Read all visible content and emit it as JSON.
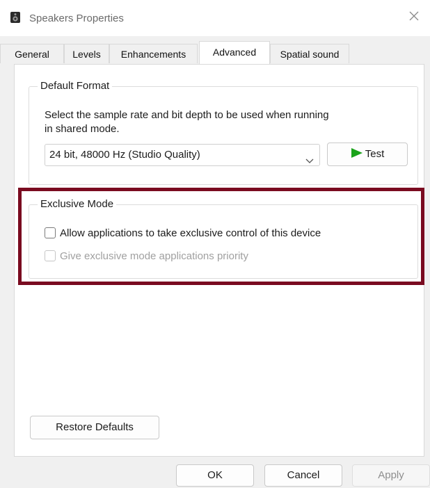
{
  "window": {
    "title": "Speakers Properties"
  },
  "tabs": [
    {
      "label": "General"
    },
    {
      "label": "Levels"
    },
    {
      "label": "Enhancements"
    },
    {
      "label": "Advanced"
    },
    {
      "label": "Spatial sound"
    }
  ],
  "active_tab": "Advanced",
  "default_format": {
    "legend": "Default Format",
    "description_line1": "Select the sample rate and bit depth to be used when running",
    "description_line2": "in shared mode.",
    "selected_format": "24 bit, 48000 Hz (Studio Quality)",
    "test_label": "Test"
  },
  "exclusive_mode": {
    "legend": "Exclusive Mode",
    "allow_exclusive_label": "Allow applications to take exclusive control of this device",
    "allow_exclusive_checked": false,
    "priority_label": "Give exclusive mode applications priority",
    "priority_checked": false,
    "priority_enabled": false
  },
  "restore_defaults_label": "Restore Defaults",
  "footer": {
    "ok_label": "OK",
    "cancel_label": "Cancel",
    "apply_label": "Apply"
  },
  "colors": {
    "highlight_border": "#7a0b20",
    "test_play_icon": "#1aa31a"
  }
}
